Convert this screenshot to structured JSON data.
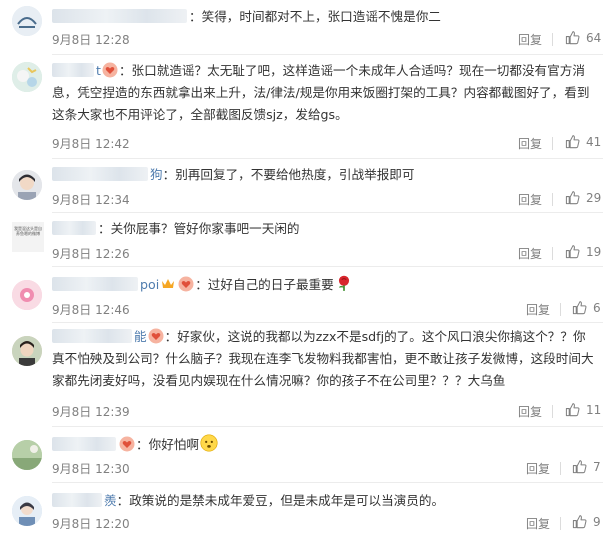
{
  "comments": [
    {
      "user_tail": "",
      "text": "：笑得，时间都对不上，张口造谣不愧是你二",
      "date": "9月8日",
      "time": "12:28",
      "reply": "回复",
      "likes": "64",
      "avatar_color": "#dbe7f0"
    },
    {
      "user_tail": "t",
      "text": "：张口就造谣？太无耻了吧，这样造谣一个未成年人合适吗？现在一切都没有官方消息，凭空捏造的东西就拿出来上升，法/律法/规是你用来饭圈打架的工具？内容都截图好了，看到这条大家也不用评论了，全部截图反馈sjz，发给gs。",
      "date": "9月8日",
      "time": "12:42",
      "reply": "回复",
      "likes": "41",
      "avatar_color": "#c9e4d6"
    },
    {
      "user_tail": "狗",
      "text": "：别再回复了，不要给他热度，引战举报即可",
      "date": "9月8日",
      "time": "12:34",
      "reply": "回复",
      "likes": "29",
      "avatar_color": "#d7d9de"
    },
    {
      "user_tail": "",
      "text": "：关你屁事？管好你家事吧一天闲的",
      "date": "9月8日",
      "time": "12:26",
      "reply": "回复",
      "likes": "19",
      "avatar_color": "#f0f0f0",
      "avatar_text": "我是混这头是自养鱼嗯的微博"
    },
    {
      "user_tail": "poi",
      "text": "：过好自己的日子最重要",
      "date": "9月8日",
      "time": "12:46",
      "reply": "回复",
      "likes": "6",
      "avatar_color": "#f6c8d6"
    },
    {
      "user_tail": "能",
      "text": "：好家伙，这说的我都以为zzx不是sdfj的了。这个风口浪尖你搞这个？？你真不怕殃及到公司？什么脑子？我现在连李飞发物料我都害怕，更不敢让孩子发微博，这段时间大家都先闭麦好吗，没看见内娱现在什么情况嘛？你的孩子不在公司里？？？大乌鱼",
      "date": "9月8日",
      "time": "12:39",
      "reply": "回复",
      "likes": "11",
      "avatar_color": "#d9c7b4"
    },
    {
      "user_tail": "",
      "text": "：你好怕啊",
      "date": "9月8日",
      "time": "12:30",
      "reply": "回复",
      "likes": "7",
      "avatar_color": "#a9c79a"
    },
    {
      "user_tail": "羨",
      "text": "：政策说的是禁未成年爱豆，但是未成年是可以当演员的。",
      "date": "9月8日",
      "time": "12:20",
      "reply": "回复",
      "likes": "9",
      "avatar_color": "#cfe0ef"
    }
  ],
  "colors": {
    "text": "#333333",
    "meta": "#808080",
    "link": "#4f7cae",
    "divider": "#ececec"
  },
  "icons": {
    "like": "thumbs-up-icon",
    "badge_vip": "crown-badge-icon",
    "badge_fan": "heart-badge-icon",
    "emoji_rose": "rose-emoji-icon",
    "emoji_fear": "fearful-face-emoji-icon"
  }
}
